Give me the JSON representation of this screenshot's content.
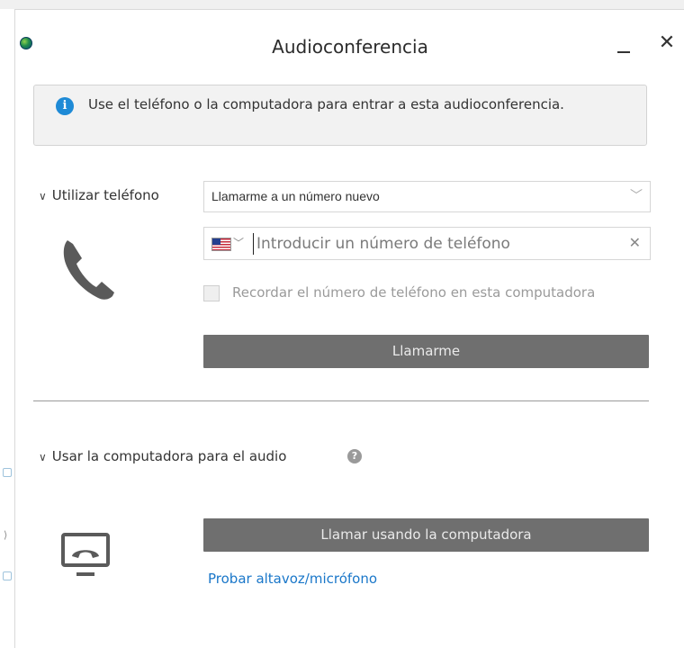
{
  "window": {
    "title": "Audioconferencia",
    "minimize_icon": "minimize-icon",
    "close_symbol": "✕"
  },
  "info": {
    "icon": "i",
    "text": "Use el teléfono o la computadora para entrar a esta audioconferencia."
  },
  "phone_section": {
    "header": "Utilizar teléfono",
    "dropdown_value": "Llamarme a un número nuevo",
    "dropdown_chevron": "﹀",
    "country_chevron": "﹀",
    "phone_placeholder": "Introducir un número de teléfono",
    "phone_value": "",
    "clear_symbol": "✕",
    "remember_label": "Recordar el número de teléfono en esta computadora",
    "remember_checked": false,
    "call_me_button": "Llamarme",
    "illustration_icon": "phone-handset-icon"
  },
  "computer_section": {
    "header": "Usar la computadora para el audio",
    "help_symbol": "?",
    "call_button": "Llamar usando la computadora",
    "test_link": "Probar altavoz/micrófono",
    "illustration_icon": "computer-call-icon"
  },
  "colors": {
    "button_gray": "#6f6f6f",
    "link_blue": "#1a77c9",
    "info_blue": "#1e8ad6",
    "illustration_gray": "#5a5a5a"
  }
}
